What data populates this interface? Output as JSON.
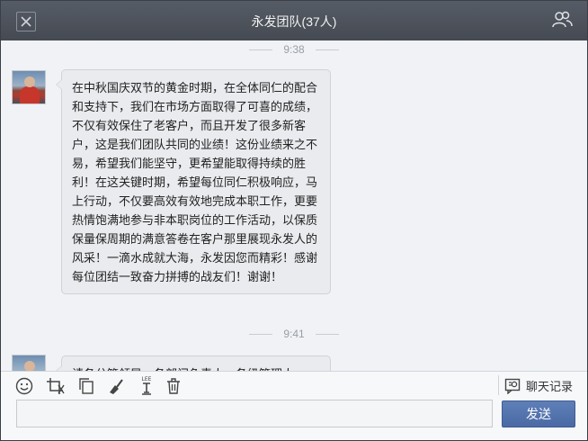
{
  "window": {
    "title": "永发团队(37人)"
  },
  "chat": {
    "messages": [
      {
        "time": "9:38",
        "text": "在中秋国庆双节的黄金时期，在全体同仁的配合和支持下，我们在市场方面取得了可喜的成绩，不仅有效保住了老客户，而且开发了很多新客户，这是我们团队共同的业绩！这份业绩来之不易，希望我们能坚守，更希望能取得持续的胜利！在这关键时期，希望每位同仁积极响应，马上行动，不仅要高效有效地完成本职工作，更要热情饱满地参与非本职岗位的工作活动，以保质保量保周期的满意答卷在客户那里展现永发人的风采！一滴水成就大海，永发因您而精彩！感谢每位团结一致奋力拼搏的战友们！谢谢！"
      },
      {
        "time": "9:41",
        "text": "请各分管领导、各部门负责人、各级管理人"
      }
    ]
  },
  "toolbar": {
    "tools": [
      "emoji-icon",
      "screenshot-icon",
      "copy-icon",
      "clear-icon",
      "font-icon",
      "delete-icon"
    ],
    "font_icon_label": "LEE",
    "history_label": "聊天记录"
  },
  "composer": {
    "value": "",
    "send_label": "发送"
  },
  "colors": {
    "titlebar": "#4b5058",
    "send_button": "#5572ad",
    "bubble": "#e9ebee"
  }
}
